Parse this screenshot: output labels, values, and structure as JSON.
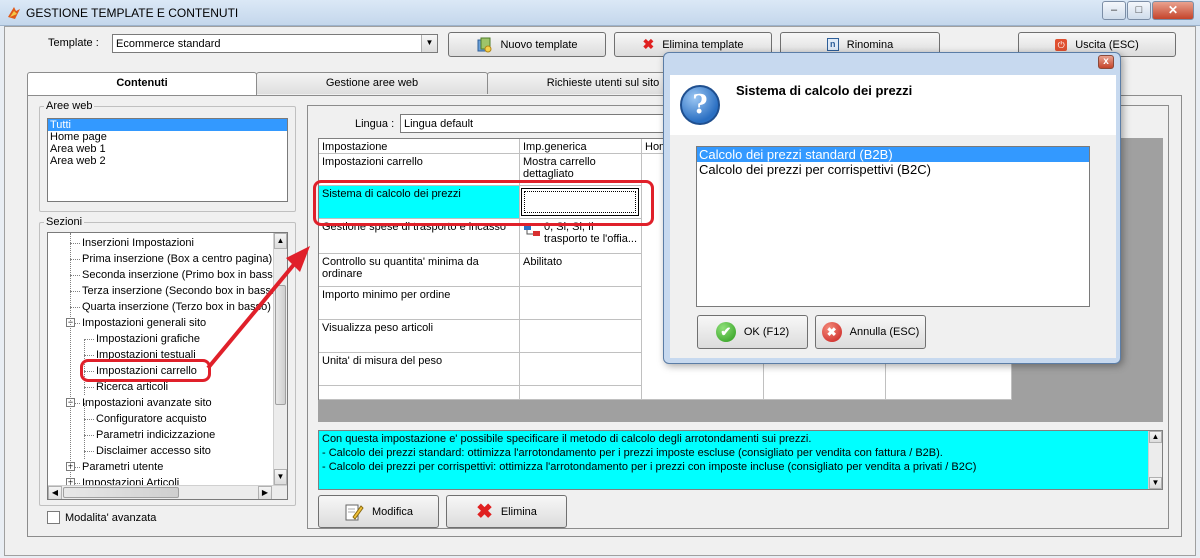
{
  "window": {
    "title": "GESTIONE TEMPLATE E CONTENUTI",
    "controls": {
      "minimize": "–",
      "maximize": "□",
      "close": "✕"
    }
  },
  "toolbar": {
    "template_label": "Template :",
    "template_value": "Ecommerce standard",
    "new_template": "Nuovo template",
    "delete_template": "Elimina template",
    "rename": "Rinomina",
    "exit": "Uscita (ESC)"
  },
  "tabs": [
    {
      "label": "Contenuti"
    },
    {
      "label": "Gestione aree web"
    },
    {
      "label": "Richieste utenti sul sito"
    }
  ],
  "aree_web": {
    "legend": "Aree web",
    "items": [
      "Tutti",
      "Home page",
      "Area web 1",
      "Area web 2"
    ],
    "selected": 0
  },
  "sezioni": {
    "legend": "Sezioni",
    "tree": [
      {
        "label": "Inserzioni Impostazioni",
        "level": 1,
        "expander": ""
      },
      {
        "label": "Prima inserzione (Box a centro pagina)",
        "level": 1,
        "expander": ""
      },
      {
        "label": "Seconda inserzione (Primo box in basso)",
        "level": 1,
        "expander": ""
      },
      {
        "label": "Terza inserzione (Secondo box in basso)",
        "level": 1,
        "expander": ""
      },
      {
        "label": "Quarta inserzione (Terzo box in basso)",
        "level": 1,
        "expander": ""
      },
      {
        "label": "Impostazioni generali sito",
        "level": 1,
        "expander": "−"
      },
      {
        "label": "Impostazioni grafiche",
        "level": 2,
        "expander": ""
      },
      {
        "label": "Impostazioni testuali",
        "level": 2,
        "expander": ""
      },
      {
        "label": "Impostazioni carrello",
        "level": 2,
        "expander": ""
      },
      {
        "label": "Ricerca articoli",
        "level": 2,
        "expander": ""
      },
      {
        "label": "Impostazioni avanzate sito",
        "level": 1,
        "expander": "−"
      },
      {
        "label": "Configuratore acquisto",
        "level": 2,
        "expander": ""
      },
      {
        "label": "Parametri indicizzazione",
        "level": 2,
        "expander": ""
      },
      {
        "label": "Disclaimer accesso sito",
        "level": 2,
        "expander": ""
      },
      {
        "label": "Parametri utente",
        "level": 1,
        "expander": "+"
      },
      {
        "label": "Impostazioni Articoli",
        "level": 1,
        "expander": "+"
      }
    ]
  },
  "modalita": {
    "label": "Modalita' avanzata"
  },
  "lingua": {
    "label": "Lingua :",
    "value": "Lingua default"
  },
  "grid": {
    "headers": [
      "Impostazione",
      "Imp.generica",
      "Hom"
    ],
    "rows": [
      {
        "name": "Impostazioni carrello",
        "value": "Mostra carrello dettagliato"
      },
      {
        "name": "Sistema di calcolo dei prezzi",
        "value": ""
      },
      {
        "name": "Gestione spese di trasporto e incasso",
        "value": "0, Si, Si, Il trasporto te l'offia..."
      },
      {
        "name": "Controllo su quantita' minima da ordinare",
        "value": "Abilitato"
      },
      {
        "name": "Importo minimo per ordine",
        "value": ""
      },
      {
        "name": "Visualizza peso articoli",
        "value": ""
      },
      {
        "name": "Unita' di misura del peso",
        "value": ""
      }
    ]
  },
  "info": {
    "lines": [
      "Con questa impostazione e' possibile specificare il metodo di calcolo degli arrotondamenti sui prezzi.",
      "- Calcolo dei prezzi standard: ottimizza l'arrotondamento per i prezzi imposte escluse (consigliato per vendita con fattura / B2B).",
      "- Calcolo dei prezzi per corrispettivi: ottimizza l'arrotondamento per i prezzi con imposte incluse (consigliato per vendita a privati / B2C)"
    ]
  },
  "actions": {
    "modify": "Modifica",
    "delete": "Elimina"
  },
  "dialog": {
    "title": "Sistema di calcolo dei prezzi",
    "options": [
      "Calcolo dei prezzi standard (B2B)",
      "Calcolo dei prezzi per corrispettivi (B2C)"
    ],
    "selected": 0,
    "ok": "OK (F12)",
    "cancel": "Annulla (ESC)",
    "close": "x"
  }
}
